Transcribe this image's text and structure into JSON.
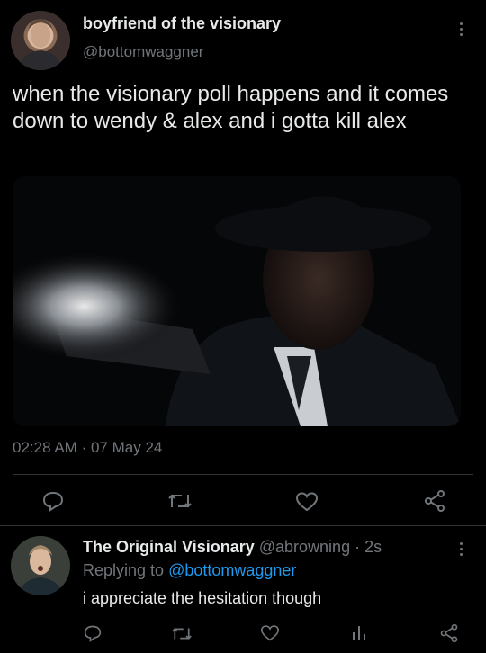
{
  "tweet": {
    "author_name": "boyfriend of the visionary",
    "author_handle": "@bottomwaggner",
    "text": "when the visionary poll happens and it comes down to wendy & alex and i gotta kill alex",
    "time": "02:28 AM",
    "separator": "·",
    "date": "07 May 24",
    "media_icon": "photo"
  },
  "reply": {
    "author_name": "The Original Visionary",
    "author_handle": "@abrowning",
    "time_sep": "·",
    "time_ago": "2s",
    "replying_to_label": "Replying to",
    "replying_to_handle": "@bottomwaggner",
    "text": "i appreciate the hesitation though"
  },
  "icons": {
    "reply": "reply-icon",
    "retweet": "retweet-icon",
    "like": "heart-icon",
    "share": "share-icon",
    "views": "analytics-icon",
    "more": "more-icon"
  },
  "colors": {
    "background": "#000000",
    "text": "#e7e9ea",
    "muted": "#71767b",
    "accent": "#1d9bf0",
    "divider": "#2f3336"
  }
}
